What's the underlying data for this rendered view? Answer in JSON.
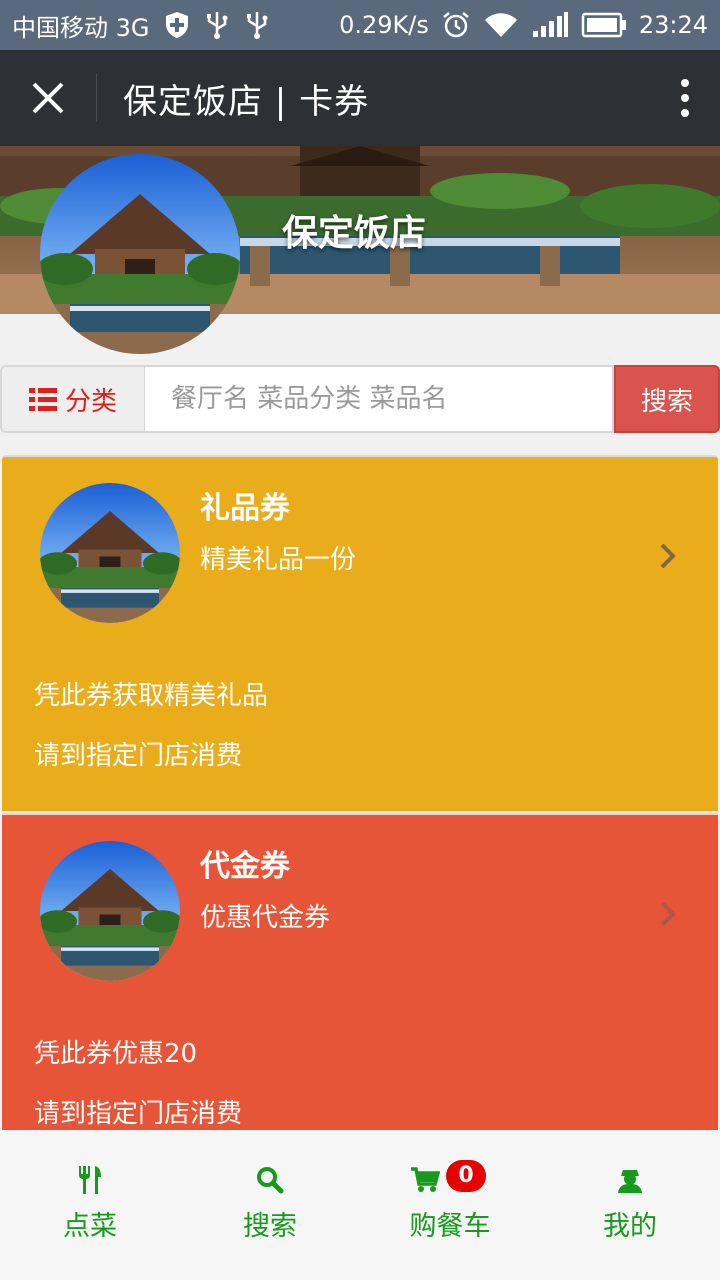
{
  "status_bar": {
    "carrier": "中国移动 3G",
    "speed": "0.29K/s",
    "time": "23:24",
    "icons": [
      "shield-plus-icon",
      "usb-icon",
      "usb-icon",
      "alarm-icon",
      "wifi-icon",
      "signal-icon",
      "battery-icon"
    ]
  },
  "title_bar": {
    "title": "保定饭店 | 卡券",
    "close_icon": "close-icon",
    "more_icon": "more-vertical-icon"
  },
  "banner": {
    "restaurant_name": "保定饭店"
  },
  "search": {
    "category_label": "分类",
    "category_icon": "list-icon",
    "placeholder": "餐厅名 菜品分类 菜品名",
    "button_label": "搜索"
  },
  "coupons": [
    {
      "title": "礼品券",
      "subtitle": "精美礼品一份",
      "line1": "凭此券获取精美礼品",
      "line2": "请到指定门店消费",
      "color": "#e9ac1a"
    },
    {
      "title": "代金券",
      "subtitle": "优惠代金券",
      "line1": "凭此券优惠20",
      "line2": "请到指定门店消费",
      "color": "#e75538"
    }
  ],
  "bottom_nav": {
    "items": [
      {
        "label": "点菜",
        "icon": "cutlery-icon"
      },
      {
        "label": "搜索",
        "icon": "search-icon"
      },
      {
        "label": "购餐车",
        "icon": "cart-icon",
        "badge": "0"
      },
      {
        "label": "我的",
        "icon": "user-icon"
      }
    ],
    "accent": "#179a1b"
  }
}
